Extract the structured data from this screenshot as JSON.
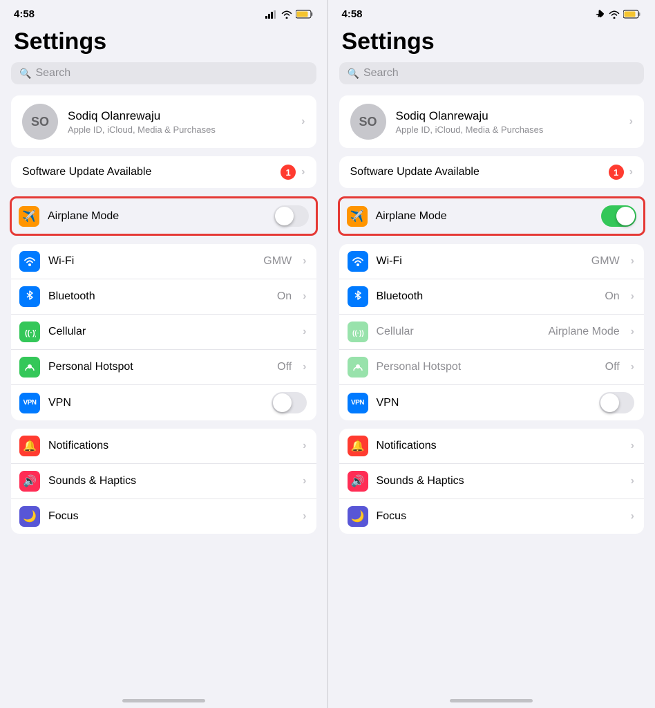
{
  "panels": [
    {
      "id": "left",
      "statusBar": {
        "time": "4:58",
        "moonIcon": true,
        "airplaneMode": false,
        "signalBars": true,
        "wifi": true,
        "battery": true
      },
      "title": "Settings",
      "search": {
        "placeholder": "Search"
      },
      "profile": {
        "initials": "SO",
        "name": "Sodiq Olanrewaju",
        "subtitle": "Apple ID, iCloud, Media & Purchases"
      },
      "update": {
        "label": "Software Update Available",
        "badge": "1"
      },
      "airplaneMode": {
        "label": "Airplane Mode",
        "toggleState": "off"
      },
      "networkRows": [
        {
          "icon": "wifi",
          "label": "Wi-Fi",
          "value": "GMW",
          "chevron": true
        },
        {
          "icon": "bluetooth",
          "label": "Bluetooth",
          "value": "On",
          "chevron": true
        },
        {
          "icon": "cellular",
          "label": "Cellular",
          "value": "",
          "chevron": true
        },
        {
          "icon": "hotspot",
          "label": "Personal Hotspot",
          "value": "Off",
          "chevron": true
        },
        {
          "icon": "vpn",
          "label": "VPN",
          "value": "",
          "toggle": "off"
        }
      ],
      "generalRows": [
        {
          "icon": "notifications",
          "label": "Notifications",
          "chevron": true
        },
        {
          "icon": "sounds",
          "label": "Sounds & Haptics",
          "chevron": true
        },
        {
          "icon": "focus",
          "label": "Focus",
          "chevron": true
        }
      ]
    },
    {
      "id": "right",
      "statusBar": {
        "time": "4:58",
        "moonIcon": true,
        "airplaneMode": true,
        "wifi": true,
        "battery": true
      },
      "title": "Settings",
      "search": {
        "placeholder": "Search"
      },
      "profile": {
        "initials": "SO",
        "name": "Sodiq Olanrewaju",
        "subtitle": "Apple ID, iCloud, Media & Purchases"
      },
      "update": {
        "label": "Software Update Available",
        "badge": "1"
      },
      "airplaneMode": {
        "label": "Airplane Mode",
        "toggleState": "on"
      },
      "networkRows": [
        {
          "icon": "wifi",
          "label": "Wi-Fi",
          "value": "GMW",
          "chevron": true
        },
        {
          "icon": "bluetooth",
          "label": "Bluetooth",
          "value": "On",
          "chevron": true
        },
        {
          "icon": "cellular",
          "label": "Cellular",
          "value": "Airplane Mode",
          "chevron": true,
          "dimmed": true
        },
        {
          "icon": "hotspot",
          "label": "Personal Hotspot",
          "value": "Off",
          "chevron": true,
          "dimmed": true
        },
        {
          "icon": "vpn",
          "label": "VPN",
          "value": "",
          "toggle": "off"
        }
      ],
      "generalRows": [
        {
          "icon": "notifications",
          "label": "Notifications",
          "chevron": true
        },
        {
          "icon": "sounds",
          "label": "Sounds & Haptics",
          "chevron": true
        },
        {
          "icon": "focus",
          "label": "Focus",
          "chevron": true
        }
      ]
    }
  ],
  "icons": {
    "wifi": "📶",
    "bluetooth": "🔵",
    "cellular": "📡",
    "hotspot": "📱",
    "vpn": "VPN",
    "notifications": "🔔",
    "sounds": "🔊",
    "focus": "🌙"
  }
}
